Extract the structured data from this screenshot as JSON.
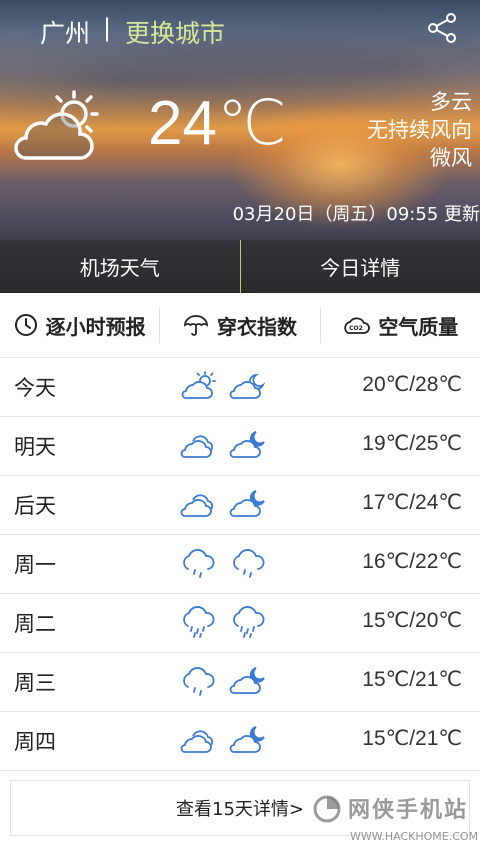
{
  "header": {
    "city": "广州",
    "separator": "|",
    "change_city_label": "更换城市",
    "share_icon": "share-icon"
  },
  "current": {
    "temperature": "24℃",
    "condition": "多云",
    "wind_direction": "无持续风向",
    "wind_strength": "微风",
    "updated": "03月20日（周五）09:55 更新",
    "icon": "partly-cloudy-sun-icon"
  },
  "subtabs": [
    {
      "label": "机场天气"
    },
    {
      "label": "今日详情"
    }
  ],
  "features": [
    {
      "label": "逐小时预报",
      "icon": "clock-icon"
    },
    {
      "label": "穿衣指数",
      "icon": "umbrella-icon"
    },
    {
      "label": "空气质量",
      "icon": "co2-cloud-icon"
    }
  ],
  "forecast": [
    {
      "day": "今天",
      "day_icon": "cloud-sun-icon",
      "night_icon": "cloud-moon-icon",
      "range": "20℃/28℃"
    },
    {
      "day": "明天",
      "day_icon": "cloudy-icon",
      "night_icon": "cloud-moon-icon",
      "range": "19℃/25℃"
    },
    {
      "day": "后天",
      "day_icon": "cloudy-icon",
      "night_icon": "cloud-moon-icon",
      "range": "17℃/24℃"
    },
    {
      "day": "周一",
      "day_icon": "light-rain-icon",
      "night_icon": "light-rain-icon",
      "range": "16℃/22℃"
    },
    {
      "day": "周二",
      "day_icon": "rain-icon",
      "night_icon": "rain-icon",
      "range": "15℃/20℃"
    },
    {
      "day": "周三",
      "day_icon": "light-rain-icon",
      "night_icon": "cloud-moon-icon",
      "range": "15℃/21℃"
    },
    {
      "day": "周四",
      "day_icon": "cloudy-icon",
      "night_icon": "cloud-moon-icon",
      "range": "15℃/21℃"
    }
  ],
  "more_label": "查看15天详情>",
  "watermark": {
    "name": "网侠手机站",
    "url": "WWW.HACKHOME.COM"
  },
  "colors": {
    "accent": "#d7e79a",
    "icon_blue": "#3a7bd5",
    "text": "#222222"
  }
}
